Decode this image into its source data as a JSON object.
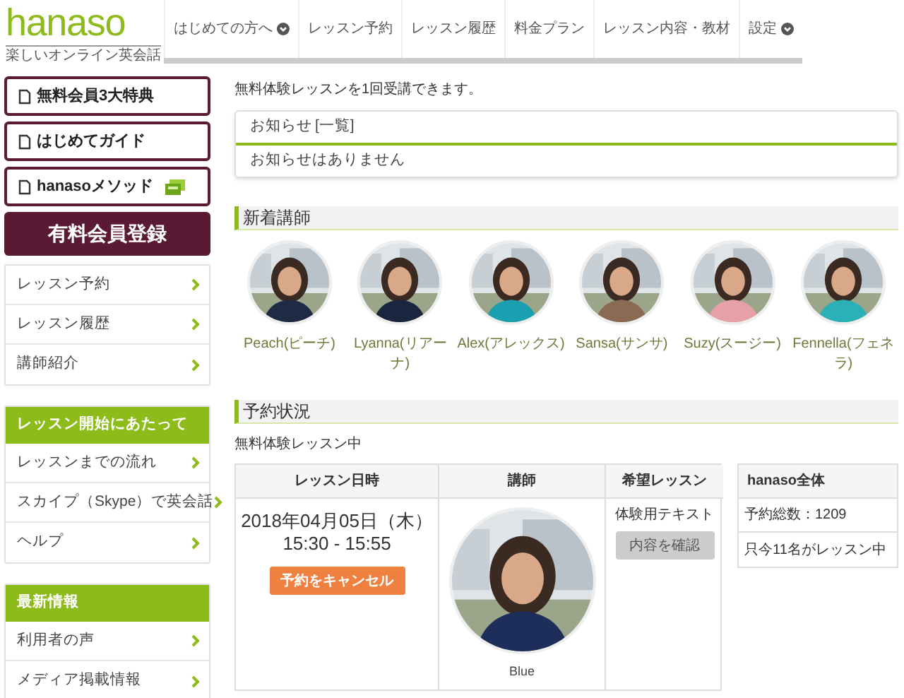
{
  "logo": {
    "name": "hanaso",
    "tagline": "楽しいオンライン英会話"
  },
  "nav": [
    {
      "label": "はじめての方へ",
      "dropdown": true
    },
    {
      "label": "レッスン予約",
      "dropdown": false
    },
    {
      "label": "レッスン履歴",
      "dropdown": false
    },
    {
      "label": "料金プラン",
      "dropdown": false
    },
    {
      "label": "レッスン内容・教材",
      "dropdown": false
    },
    {
      "label": "設定",
      "dropdown": true
    }
  ],
  "sidebar": {
    "guides": [
      {
        "label": "無料会員3大特典",
        "badge": false
      },
      {
        "label": "はじめてガイド",
        "badge": false
      },
      {
        "label": "hanasoメソッド",
        "badge": true
      }
    ],
    "register_button": "有料会員登録",
    "menu": [
      "レッスン予約",
      "レッスン履歴",
      "講師紹介"
    ],
    "groups": [
      {
        "title": "レッスン開始にあたって",
        "items": [
          "レッスンまでの流れ",
          "スカイプ（Skype）で英会話",
          "ヘルプ"
        ]
      },
      {
        "title": "最新情報",
        "items": [
          "利用者の声",
          "メディア掲載情報"
        ]
      }
    ]
  },
  "intro": "無料体験レッスンを1回受講できます。",
  "notices": {
    "title": "お知らせ",
    "link": "[一覧]",
    "message": "お知らせはありません"
  },
  "new_teachers": {
    "title": "新着講師",
    "teachers": [
      {
        "name": "Peach(ピーチ)"
      },
      {
        "name": "Lyanna(リアーナ)"
      },
      {
        "name": "Alex(アレックス)"
      },
      {
        "name": "Sansa(サンサ)"
      },
      {
        "name": "Suzy(スージー)"
      },
      {
        "name": "Fennella(フェネラ)"
      }
    ]
  },
  "reservation": {
    "title": "予約状況",
    "status": "無料体験レッスン中",
    "columns": [
      "レッスン日時",
      "講師",
      "希望レッスン"
    ],
    "date": "2018年04月05日（木）",
    "time": "15:30 - 15:55",
    "cancel_button": "予約をキャンセル",
    "teacher": "Blue",
    "lesson": "体験用テキスト",
    "details_button": "内容を確認"
  },
  "summary": {
    "title": "hanaso全体",
    "rows": [
      "予約総数：1209",
      "只今11名がレッスン中"
    ]
  }
}
